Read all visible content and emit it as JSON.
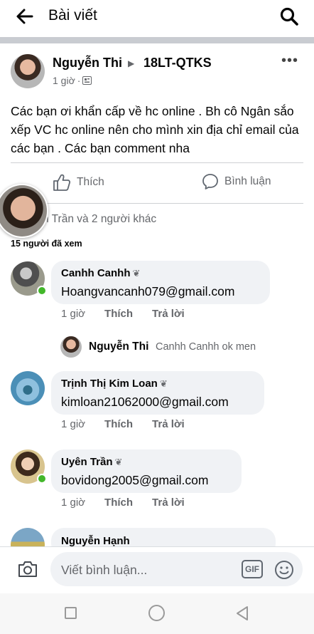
{
  "header": {
    "title": "Bài viết"
  },
  "post": {
    "author": "Nguyễn Thi",
    "group": "18LT-QTKS",
    "time": "1 giờ",
    "text": "Các bạn ơi khẩn cấp về hc online . Bh cô Ngân sắo xếp VC hc online nên cho mình xin địa chỉ email của các bạn . Các bạn comment nha",
    "like_label": "Thích",
    "comment_label": "Bình luận",
    "reactions_text": "n Trần và 2 người khác",
    "seen_text": "15 người đã xem"
  },
  "comments": [
    {
      "name": "Canhh Canhh",
      "text": "Hoangvancanh079@gmail.com",
      "time": "1 giờ",
      "like": "Thích",
      "reply": "Trả lời",
      "online": true
    },
    {
      "name": "Trịnh Thị Kim Loan",
      "text": "kimloan21062000@gmail.com",
      "time": "1 giờ",
      "like": "Thích",
      "reply": "Trả lời",
      "online": false
    },
    {
      "name": "Uyên Trần",
      "text": "bovidong2005@gmail.com",
      "time": "1 giờ",
      "like": "Thích",
      "reply": "Trả lời",
      "online": true
    },
    {
      "name": "Nguyễn Hạnh"
    }
  ],
  "reply": {
    "name": "Nguyễn Thi",
    "text": "Canhh Canhh ok men"
  },
  "composer": {
    "placeholder": "Viết bình luận...",
    "gif_label": "GIF"
  },
  "icons": {
    "back": "back-arrow-icon",
    "search": "search-icon",
    "more": "more-icon",
    "audience": "group-audience-icon",
    "like": "thumbs-up-icon",
    "comment": "comment-bubble-icon",
    "camera": "camera-icon",
    "emoji": "emoji-icon",
    "verified": "leaf-badge-icon"
  },
  "colors": {
    "online": "#42b72a",
    "secondary_text": "#65676b",
    "bubble": "#f0f2f5",
    "separator": "#c9ccd1"
  }
}
